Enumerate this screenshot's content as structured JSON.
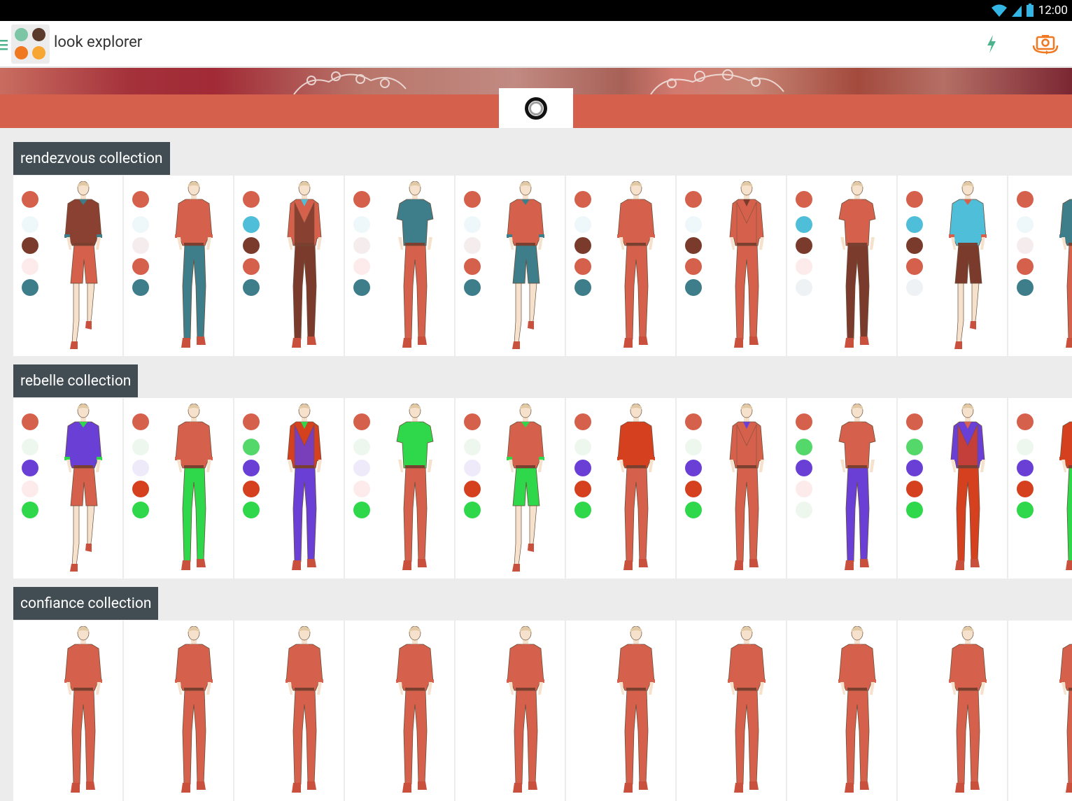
{
  "status_bar": {
    "time": "12:00"
  },
  "app_bar": {
    "title": "look explorer",
    "logo_colors": [
      "#7cc6a6",
      "#5a3a2a",
      "#f07820",
      "#f7a533"
    ],
    "actions": [
      {
        "icon": "flash-icon",
        "color": "#4cb38c"
      },
      {
        "icon": "switch-camera-icon",
        "color": "#f07820"
      }
    ]
  },
  "palette": {
    "accent_band": "#d5604b",
    "label_bg": "#414c53"
  },
  "collections": [
    {
      "name": "rendezvous collection",
      "looks": [
        {
          "swatches": [
            "#d5604b",
            "#eef7fa",
            "#7b3b2c",
            "#fcebea",
            "#3e7e8b"
          ],
          "shirt": "#8a4131",
          "pants": "#d5604b",
          "style": "shorts",
          "collar": "#3e7e8b"
        },
        {
          "swatches": [
            "#d5604b",
            "#eef7fa",
            "#f5eded",
            "#d5604b",
            "#3e7e8b"
          ],
          "shirt": "#d5604b",
          "pants": "#3e7e8b",
          "style": "long",
          "collar": "#d5604b"
        },
        {
          "swatches": [
            "#d5604b",
            "#4fbfd9",
            "#7b3b2c",
            "#d5604b",
            "#3e7e8b"
          ],
          "shirt": "#d5604b",
          "pants": "#7b3b2c",
          "style": "vest",
          "collar": "#4fbfd9"
        },
        {
          "swatches": [
            "#d5604b",
            "#eef7fa",
            "#f5eded",
            "#fcebea",
            "#3e7e8b"
          ],
          "shirt": "#3e7e8b",
          "pants": "#d5604b",
          "style": "polo",
          "collar": "#3e7e8b"
        },
        {
          "swatches": [
            "#d5604b",
            "#eef7fa",
            "#f5eded",
            "#d5604b",
            "#3e7e8b"
          ],
          "shirt": "#d5604b",
          "pants": "#3e7e8b",
          "style": "shorts",
          "collar": "#3e7e8b"
        },
        {
          "swatches": [
            "#d5604b",
            "#eef7fa",
            "#7b3b2c",
            "#d5604b",
            "#3e7e8b"
          ],
          "shirt": "#d5604b",
          "pants": "#d5604b",
          "style": "long",
          "collar": "#d5604b"
        },
        {
          "swatches": [
            "#d5604b",
            "#eef7fa",
            "#7b3b2c",
            "#d5604b",
            "#3e7e8b"
          ],
          "shirt": "#d5604b",
          "pants": "#d5604b",
          "style": "vest",
          "collar": "#7b3b2c"
        },
        {
          "swatches": [
            "#d5604b",
            "#4fbfd9",
            "#7b3b2c",
            "#fcebea",
            "#eef2f5"
          ],
          "shirt": "#d5604b",
          "pants": "#7b3b2c",
          "style": "polo",
          "collar": "#d5604b"
        },
        {
          "swatches": [
            "#d5604b",
            "#4fbfd9",
            "#7b3b2c",
            "#d5604b",
            "#eef2f5"
          ],
          "shirt": "#4fbfd9",
          "pants": "#7b3b2c",
          "style": "shorts",
          "collar": "#d5604b"
        },
        {
          "swatches": [
            "#d5604b",
            "#eef7fa",
            "#f5eded",
            "#d5604b",
            "#3e7e8b"
          ],
          "shirt": "#3e7e8b",
          "pants": "#d5604b",
          "style": "long",
          "collar": "#3e7e8b"
        }
      ]
    },
    {
      "name": "rebelle collection",
      "looks": [
        {
          "swatches": [
            "#d5604b",
            "#eef7ee",
            "#6a3fd6",
            "#fcebea",
            "#2ed84a"
          ],
          "shirt": "#6a3fd6",
          "pants": "#d5604b",
          "style": "shorts",
          "collar": "#2ed84a"
        },
        {
          "swatches": [
            "#d5604b",
            "#eef7ee",
            "#efeafa",
            "#d5401f",
            "#2ed84a"
          ],
          "shirt": "#d5604b",
          "pants": "#2ed84a",
          "style": "long",
          "collar": "#d5604b"
        },
        {
          "swatches": [
            "#d5604b",
            "#55d86a",
            "#6a3fd6",
            "#d5401f",
            "#2ed84a"
          ],
          "shirt": "#d5401f",
          "pants": "#6a3fd6",
          "style": "vest",
          "collar": "#2ed84a"
        },
        {
          "swatches": [
            "#d5604b",
            "#eef7ee",
            "#efeafa",
            "#fcebea",
            "#2ed84a"
          ],
          "shirt": "#2ed84a",
          "pants": "#d5604b",
          "style": "polo",
          "collar": "#2ed84a"
        },
        {
          "swatches": [
            "#d5604b",
            "#eef7ee",
            "#efeafa",
            "#d5401f",
            "#2ed84a"
          ],
          "shirt": "#d5604b",
          "pants": "#2ed84a",
          "style": "shorts",
          "collar": "#2ed84a"
        },
        {
          "swatches": [
            "#d5604b",
            "#eef7ee",
            "#6a3fd6",
            "#d5401f",
            "#2ed84a"
          ],
          "shirt": "#d5401f",
          "pants": "#d5604b",
          "style": "long",
          "collar": "#d5401f"
        },
        {
          "swatches": [
            "#d5604b",
            "#eef7ee",
            "#6a3fd6",
            "#d5401f",
            "#2ed84a"
          ],
          "shirt": "#d5604b",
          "pants": "#d5604b",
          "style": "vest",
          "collar": "#6a3fd6"
        },
        {
          "swatches": [
            "#d5604b",
            "#55d86a",
            "#6a3fd6",
            "#fcebea",
            "#eef7ee"
          ],
          "shirt": "#d5604b",
          "pants": "#6a3fd6",
          "style": "polo",
          "collar": "#d5604b"
        },
        {
          "swatches": [
            "#d5604b",
            "#55d86a",
            "#6a3fd6",
            "#d5401f",
            "#2ed84a"
          ],
          "shirt": "#6a3fd6",
          "pants": "#d5401f",
          "style": "vest",
          "collar": "#d5604b"
        },
        {
          "swatches": [
            "#d5604b",
            "#eef7ee",
            "#6a3fd6",
            "#d5401f",
            "#2ed84a"
          ],
          "shirt": "#d5401f",
          "pants": "#2ed84a",
          "style": "long",
          "collar": "#d5401f"
        }
      ]
    },
    {
      "name": "confiance collection",
      "looks": [
        {},
        {},
        {},
        {},
        {},
        {},
        {},
        {},
        {},
        {}
      ]
    }
  ]
}
